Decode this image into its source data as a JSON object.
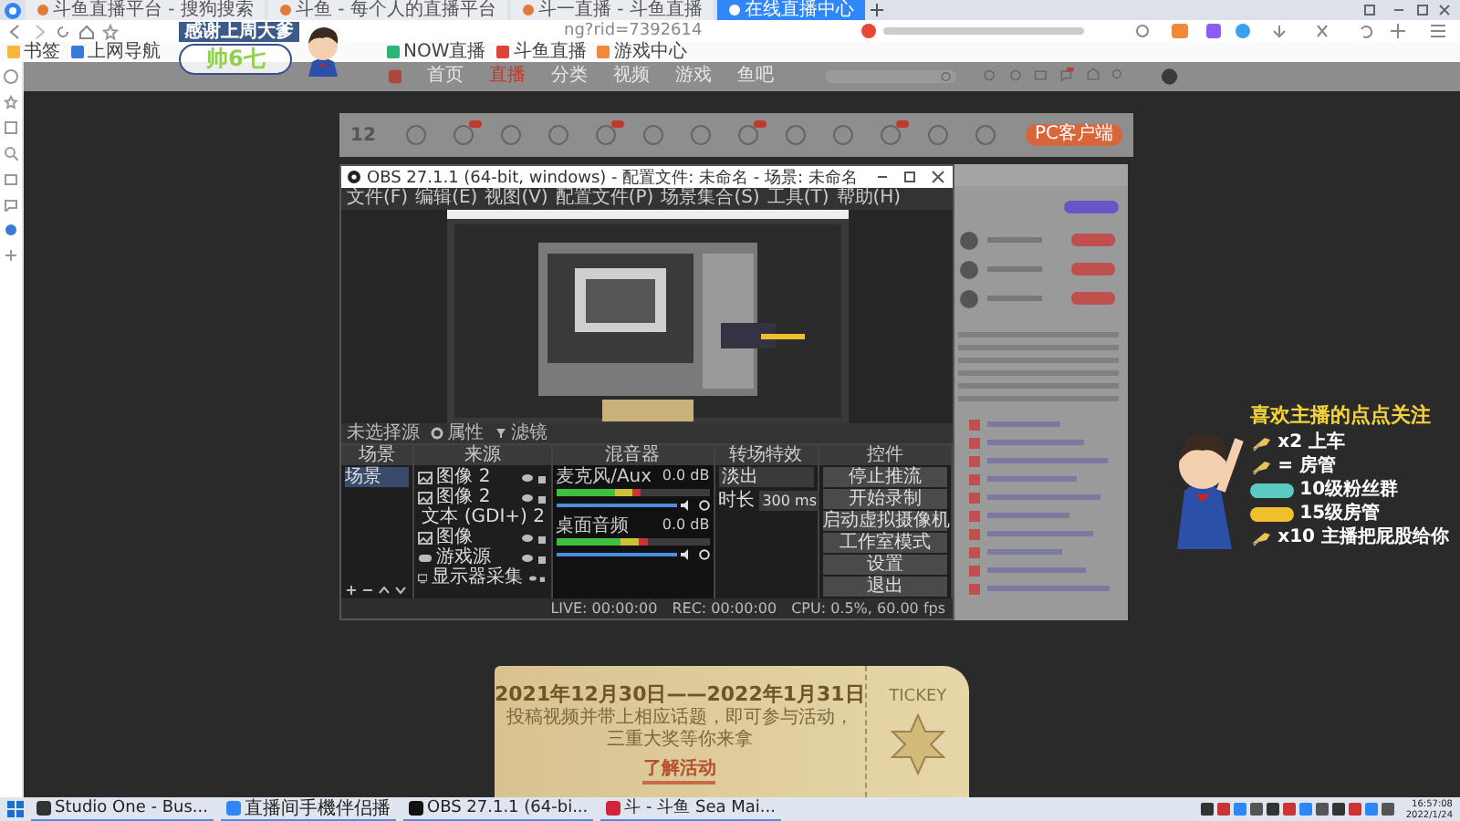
{
  "browser": {
    "tabs": [
      {
        "title": "斗鱼直播平台 - 搜狗搜索",
        "selected": false
      },
      {
        "title": "斗鱼 - 每个人的直播平台",
        "selected": false
      },
      {
        "title": "斗一直播 - 斗鱼直播",
        "selected": false
      },
      {
        "title": "在线直播中心",
        "selected": true
      }
    ],
    "address": "ng?rid=7392614",
    "bookmarks": [
      "书签",
      "上网导航",
      "NOW直播",
      "斗鱼直播",
      "游戏中心"
    ]
  },
  "streamer_overlay": {
    "thanks": "感谢上周大爹",
    "name": "帅6七"
  },
  "site_nav": {
    "items": [
      {
        "label": "首页",
        "selected": false
      },
      {
        "label": "直播",
        "selected": true
      },
      {
        "label": "分类",
        "selected": false
      },
      {
        "label": "视频",
        "selected": false
      },
      {
        "label": "游戏",
        "selected": false
      },
      {
        "label": "鱼吧",
        "selected": false
      }
    ]
  },
  "room_toolbar": {
    "count": "12",
    "client_button": "PC客户端"
  },
  "obs": {
    "title": "OBS 27.1.1 (64-bit, windows) - 配置文件: 未命名 - 场景: 未命名",
    "menus": [
      "文件(F)",
      "编辑(E)",
      "视图(V)",
      "配置文件(P)",
      "场景集合(S)",
      "工具(T)",
      "帮助(H)"
    ],
    "preview_bar": {
      "source": "未选择源",
      "properties": "属性",
      "filters": "滤镜"
    },
    "docks": {
      "scenes": "场景",
      "sources": "来源",
      "mixer": "混音器",
      "transitions": "转场特效",
      "controls": "控件"
    },
    "scenes": [
      "场景"
    ],
    "sources": [
      {
        "kind": "image",
        "name": "图像 2"
      },
      {
        "kind": "image",
        "name": "图像 2"
      },
      {
        "kind": "text",
        "name": "文本 (GDI+) 2"
      },
      {
        "kind": "image",
        "name": "图像"
      },
      {
        "kind": "game",
        "name": "游戏源"
      },
      {
        "kind": "display",
        "name": "显示器采集"
      }
    ],
    "mixer": [
      {
        "name": "麦克风/Aux",
        "reading": "0.0 dB",
        "meter": {
          "level": 0.55
        },
        "volume": {
          "level": 1
        }
      },
      {
        "name": "桌面音频",
        "reading": "0.0 dB",
        "meter": {
          "level": 0.6
        },
        "volume": {
          "level": 1
        }
      }
    ],
    "transition": {
      "value": "淡出",
      "duration_label": "时长",
      "duration": "300 ms"
    },
    "controls": [
      "停止推流",
      "开始录制",
      "启动虚拟摄像机",
      "工作室模式",
      "设置",
      "退出"
    ],
    "status": [
      "LIVE: 00:00:00",
      "REC: 00:00:00",
      "CPU: 0.5%, 60.00 fps"
    ]
  },
  "gift_overlay": {
    "title": "喜欢主播的点点关注",
    "items": [
      {
        "kind": "gift",
        "text": "x2 上车"
      },
      {
        "kind": "gift",
        "text": "= 房管"
      },
      {
        "kind": "badge",
        "color": "#5cc9c2",
        "text": "10级粉丝群"
      },
      {
        "kind": "badge",
        "color": "#f0c02c",
        "text": "15级房管"
      },
      {
        "kind": "gift",
        "text": "x10 主播把屁股给你"
      }
    ]
  },
  "ticket": {
    "date": "2021年12月30日——2022年1月31日",
    "line1": "投稿视频并带上相应话题，即可参与活动，",
    "line2": "三重大奖等你来拿",
    "button": "了解活动",
    "side": "TICKEY"
  },
  "taskbar": {
    "apps": [
      "Studio One - Bus...",
      "直播间手機伴侣播",
      "OBS 27.1.1 (64-bi...",
      "斗 - 斗鱼 Sea Mai..."
    ],
    "time": "16:57:08",
    "date": "2022/1/24"
  }
}
